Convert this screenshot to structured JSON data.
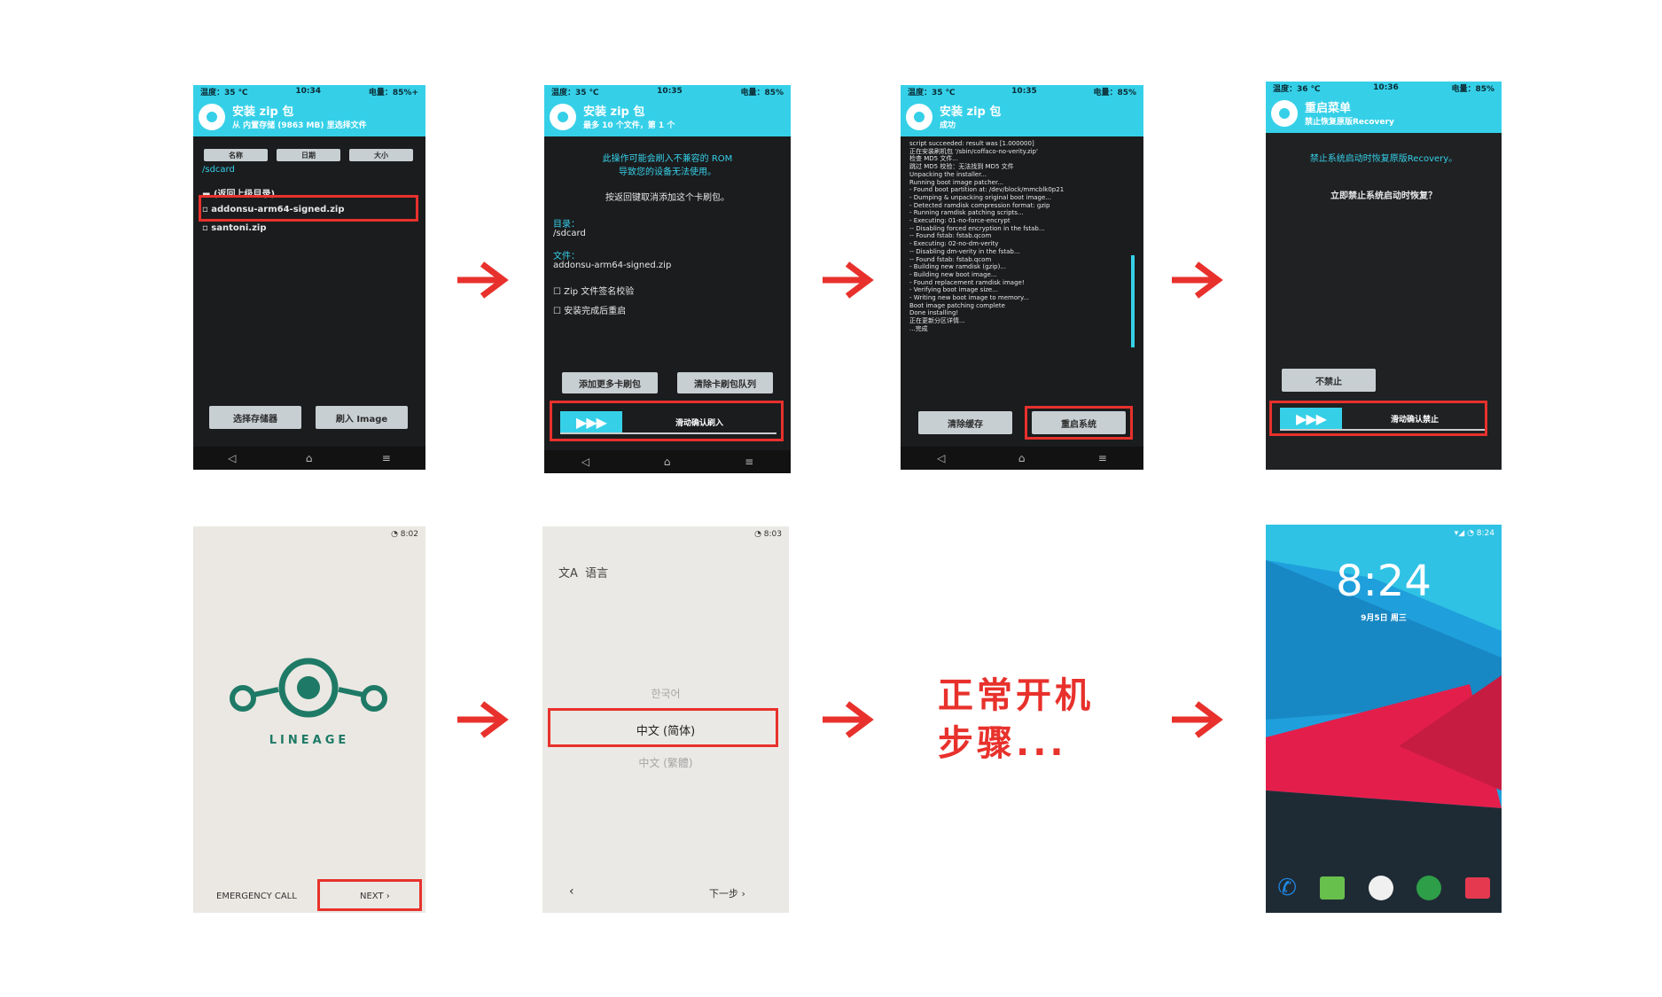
{
  "colors": {
    "accent": "#35d0e8",
    "highlight": "#e8312c"
  },
  "icons": {
    "arrow": "arrow-right-icon",
    "twrp": "twrp-logo-icon"
  },
  "screen1": {
    "status": {
      "temp": "温度：35 ℃",
      "time": "10:34",
      "battery": "电量：85%+"
    },
    "title": "安装 zip 包",
    "subtitle": "从 内置存储 (9863 MB) 里选择文件",
    "sort_buttons": [
      "名称",
      "日期",
      "大小"
    ],
    "path": "/sdcard",
    "files": [
      "(返回上级目录)",
      "addonsu-arm64-signed.zip",
      "santoni.zip"
    ],
    "btn_storage": "选择存储器",
    "btn_image": "刷入 Image"
  },
  "screen2": {
    "status": {
      "temp": "温度：35 ℃",
      "time": "10:35",
      "battery": "电量：85%"
    },
    "title": "安装 zip 包",
    "subtitle": "最多 10 个文件，第 1 个",
    "warning1": "此操作可能会刷入不兼容的 ROM",
    "warning2": "导致您的设备无法使用。",
    "hint": "按返回键取消添加这个卡刷包。",
    "dir_label": "目录：",
    "dir_value": "/sdcard",
    "file_label": "文件：",
    "file_value": "addonsu-arm64-signed.zip",
    "check1": "Zip 文件签名校验",
    "check2": "安装完成后重启",
    "btn_add": "添加更多卡刷包",
    "btn_clear": "清除卡刷包队列",
    "swipe_label": "滑动确认刷入"
  },
  "screen3": {
    "status": {
      "temp": "温度：35 ℃",
      "time": "10:35",
      "battery": "电量：85%"
    },
    "title": "安装 zip 包",
    "subtitle": "成功",
    "log": "script succeeded: result was [1.000000]\n正在安装刷机包 '/sbin/coffaco-no-verity.zip'\n检查 MD5 文件...\n跳过 MD5 校验：无法找到 MD5 文件\nUnpacking the installer...\nRunning boot image patcher...\n- Found boot partition at: /dev/block/mmcblk0p21\n- Dumping & unpacking original boot image...\n- Detected ramdisk compression format: gzip\n- Running ramdisk patching scripts...\n- Executing: 01-no-force-encrypt\n-- Disabling forced encryption in the fstab...\n-- Found fstab: fstab.qcom\n- Executing: 02-no-dm-verity\n-- Disabling dm-verity in the fstab...\n-- Found fstab: fstab.qcom\n- Building new ramdisk (gzip)...\n- Building new boot image...\n- Found replacement ramdisk image!\n- Verifying boot image size...\n- Writing new boot image to memory...\nBoot image patching complete\nDone installing!\n正在更新分区详情...\n...完成",
    "btn_wipe": "清除缓存",
    "btn_reboot": "重启系统"
  },
  "screen4": {
    "status": {
      "temp": "温度：36 ℃",
      "time": "10:36",
      "battery": "电量：85%"
    },
    "title": "重启菜单",
    "subtitle": "禁止恢复原版Recovery",
    "message": "禁止系统启动时恢复原版Recovery。",
    "question": "立即禁止系统启动时恢复？",
    "btn_no": "不禁止",
    "swipe_label": "滑动确认禁止"
  },
  "screen5": {
    "status": "8:02",
    "brand": "LINEAGE",
    "emergency": "EMERGENCY CALL",
    "next": "NEXT"
  },
  "screen6": {
    "status": "8:03",
    "lang_title": "语言",
    "languages": [
      "한국어",
      "中文 (简体)",
      "中文 (繁體)"
    ],
    "prev": "‹",
    "next": "下一步"
  },
  "caption": {
    "line1": "正常开机",
    "line2": "步骤..."
  },
  "screen8": {
    "status": "8:24",
    "clock": "8:24",
    "date": "9月5日 周三"
  }
}
